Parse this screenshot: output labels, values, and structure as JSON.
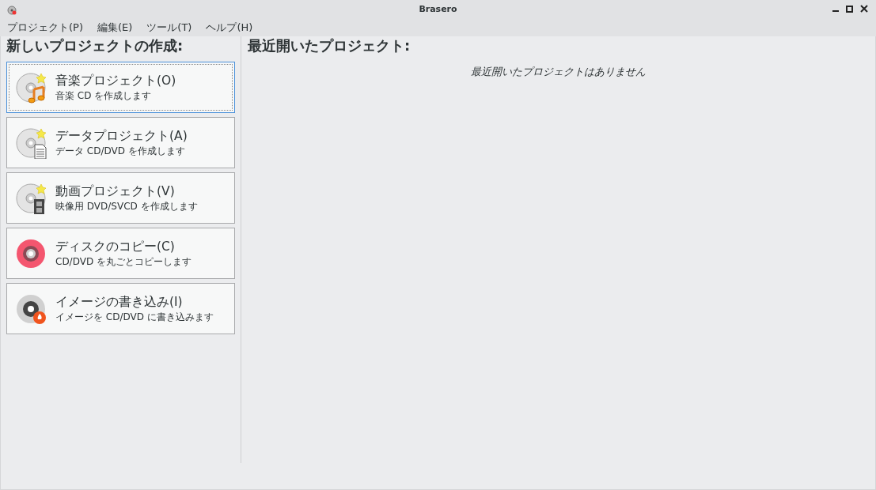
{
  "window": {
    "title": "Brasero"
  },
  "menu": [
    "プロジェクト(P)",
    "編集(E)",
    "ツール(T)",
    "ヘルプ(H)"
  ],
  "new_project": {
    "heading": "新しいプロジェクトの作成:",
    "items": [
      {
        "kind": "audio",
        "title": "音楽プロジェクト(O)",
        "subtitle": "音楽  CD を作成します",
        "selected": true
      },
      {
        "kind": "data",
        "title": "データプロジェクト(A)",
        "subtitle": "データ  CD/DVD を作成します",
        "selected": false
      },
      {
        "kind": "video",
        "title": "動画プロジェクト(V)",
        "subtitle": "映像用  DVD/SVCD を作成します",
        "selected": false
      },
      {
        "kind": "copy",
        "title": "ディスクのコピー(C)",
        "subtitle": "CD/DVD を丸ごとコピーします",
        "selected": false
      },
      {
        "kind": "burn",
        "title": "イメージの書き込み(I)",
        "subtitle": "イメージを  CD/DVD に書き込みます",
        "selected": false
      }
    ]
  },
  "recent": {
    "heading": "最近開いたプロジェクト:",
    "empty_message": "最近開いたプロジェクトはありません"
  }
}
